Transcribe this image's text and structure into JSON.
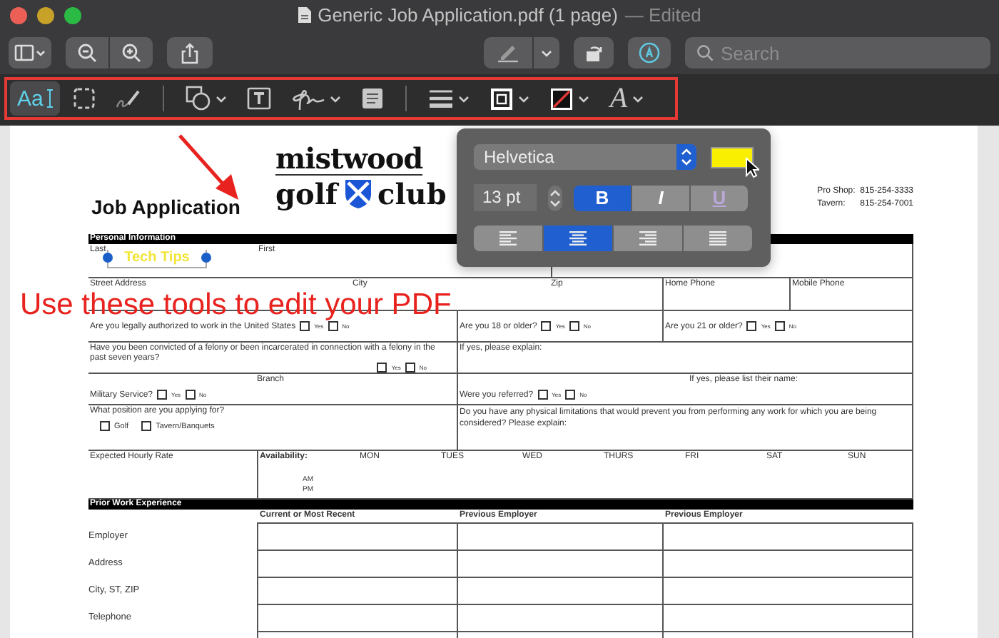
{
  "window": {
    "title": "Generic Job Application.pdf (1 page)",
    "status": "— Edited"
  },
  "toolbar": {
    "search": {
      "placeholder": "Search"
    }
  },
  "markup_tools": [
    {
      "kind": "text-selection",
      "label": "Aa",
      "selected": true,
      "menu": false
    },
    {
      "kind": "rectangular-selection",
      "selected": false,
      "menu": false
    },
    {
      "kind": "sketch",
      "selected": false,
      "menu": false
    },
    {
      "kind": "separator"
    },
    {
      "kind": "shapes",
      "selected": false,
      "menu": true
    },
    {
      "kind": "text-box",
      "selected": false,
      "menu": false
    },
    {
      "kind": "sign",
      "selected": false,
      "menu": true
    },
    {
      "kind": "note",
      "selected": false,
      "menu": false
    },
    {
      "kind": "separator"
    },
    {
      "kind": "line-style",
      "selected": false,
      "menu": true
    },
    {
      "kind": "border-color",
      "selected": false,
      "menu": true
    },
    {
      "kind": "fill-color",
      "selected": false,
      "menu": true
    },
    {
      "kind": "text-style",
      "label": "A",
      "selected": false,
      "menu": true
    }
  ],
  "font_popover": {
    "font": "Helvetica",
    "size": "13 pt",
    "styles": [
      {
        "label": "B",
        "selected": true
      },
      {
        "label": "I",
        "selected": false
      },
      {
        "label": "U",
        "selected": false
      }
    ],
    "alignments": [
      {
        "kind": "left",
        "selected": false
      },
      {
        "kind": "center",
        "selected": true
      },
      {
        "kind": "right",
        "selected": false
      },
      {
        "kind": "justify",
        "selected": false
      }
    ]
  },
  "annotations": {
    "instruction": "Use these tools to edit your PDF",
    "text_box": "Tech Tips"
  },
  "form": {
    "title": "Job Application",
    "logo": {
      "top": "mistwood",
      "left": "golf",
      "right": "club"
    },
    "contacts": [
      {
        "label": "Pro Shop:",
        "value": "815-254-3333"
      },
      {
        "label": "Tavern:",
        "value": "815-254-7001"
      }
    ],
    "personal": {
      "heading": "Personal Information",
      "name_fields": [
        "Last",
        "First"
      ],
      "address_fields": [
        "Street Address",
        "City",
        "Zip",
        "Home Phone",
        "Mobile Phone"
      ],
      "questions": [
        {
          "text": "Are you legally authorized to work in the United States",
          "options": [
            {
              "label": "Yes",
              "checked": false
            },
            {
              "label": "No",
              "checked": false
            }
          ]
        },
        {
          "text": "Are you 18 or older?",
          "options": [
            {
              "label": "Yes",
              "checked": false
            },
            {
              "label": "No",
              "checked": false
            }
          ]
        },
        {
          "text": "Are you 21 or older?",
          "options": [
            {
              "label": "Yes",
              "checked": false
            },
            {
              "label": "No",
              "checked": false
            }
          ]
        },
        {
          "text": "Have you been convicted of a felony or been incarcerated in connection with a felony in the past seven years?",
          "options": [
            {
              "label": "Yes",
              "checked": false
            },
            {
              "label": "No",
              "checked": false
            }
          ]
        },
        {
          "text": "Military Service?",
          "options": [
            {
              "label": "Yes",
              "checked": false
            },
            {
              "label": "No",
              "checked": false
            }
          ]
        },
        {
          "text": "Were you referred?",
          "options": [
            {
              "label": "Yes",
              "checked": false
            },
            {
              "label": "No",
              "checked": false
            }
          ]
        }
      ],
      "notes": [
        "If yes, please explain:",
        "Branch",
        "If yes, please list their name:"
      ],
      "position": {
        "text": "What position are you applying for?",
        "options": [
          {
            "label": "Golf",
            "checked": false
          },
          {
            "label": "Tavern/Banquets",
            "checked": false
          }
        ]
      },
      "limitations": "Do you have any physical limitations that would prevent you from performing any work for which you are being considered?  Please explain:",
      "rate": "Expected Hourly Rate",
      "availability": {
        "label": "Availability:",
        "days": [
          "MON",
          "TUES",
          "WED",
          "THURS",
          "FRI",
          "SAT",
          "SUN"
        ],
        "shifts": [
          "AM",
          "PM"
        ]
      }
    },
    "experience": {
      "heading": "Prior Work Experience",
      "columns": [
        "Current or Most Recent",
        "Previous Employer",
        "Previous Employer"
      ],
      "rows": [
        "Employer",
        "Address",
        "City, ST, ZIP",
        "Telephone"
      ]
    }
  }
}
